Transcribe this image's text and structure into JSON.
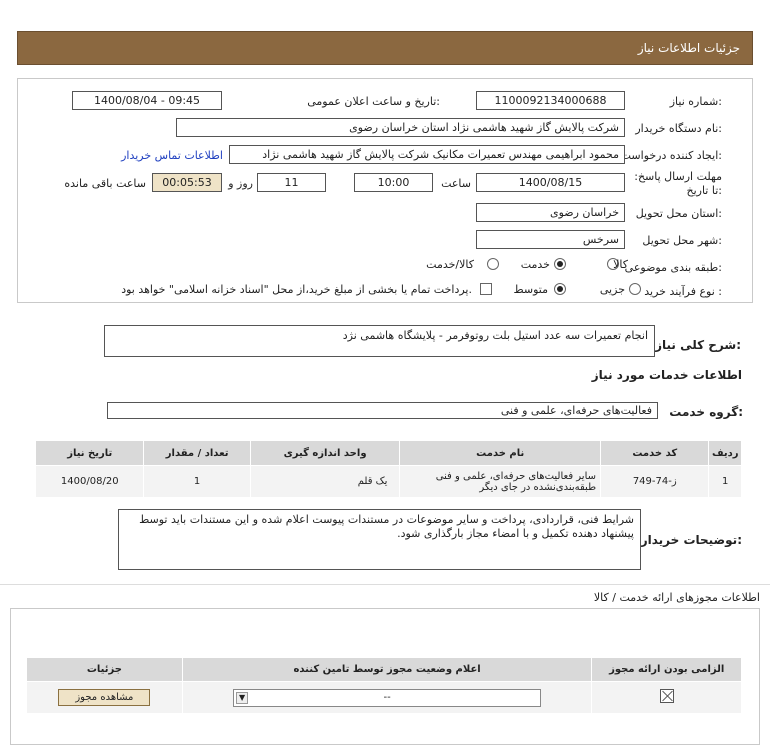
{
  "header": {
    "title": "جزئیات اطلاعات نیاز"
  },
  "fields": {
    "need_number_label": "شماره نیاز:",
    "need_number": "1100092134000688",
    "announce_label": "تاریخ و ساعت اعلان عمومی:",
    "announce_value": "1400/08/04 - 09:45",
    "buyer_org_label": "نام دستگاه خریدار:",
    "buyer_org": "شرکت پالایش گاز شهید هاشمی نژاد   استان خراسان رضوی",
    "creator_label": "ایجاد کننده درخواست:",
    "creator": "محمود ابراهیمی مهندس تعمیرات مکانیک شرکت پالایش گاز شهید هاشمی نژاد",
    "contact_link": "اطلاعات تماس خریدار",
    "deadline_label": "مهلت ارسال پاسخ: تا تاریخ:",
    "deadline_date": "1400/08/15",
    "time_label": "ساعت",
    "deadline_time": "10:00",
    "days_value": "11",
    "days_label": "روز و",
    "remaining_time": "00:05:53",
    "remaining_label": "ساعت باقی مانده",
    "province_label": "استان محل تحویل:",
    "province": "خراسان رضوی",
    "city_label": "شهر محل تحویل:",
    "city": "سرخس",
    "category_label": "طبقه بندی موضوعی:",
    "category_options": [
      "کالا",
      "خدمت",
      "کالا/خدمت"
    ],
    "category_selected": "خدمت",
    "process_label": "نوع فرآیند خرید :",
    "process_options": [
      "جزیی",
      "متوسط"
    ],
    "process_selected": "متوسط",
    "payment_note": "پرداخت تمام یا بخشی از مبلغ خرید،از محل \"اسناد خزانه اسلامی\" خواهد بود."
  },
  "summary": {
    "label": "شرح کلی نیاز:",
    "text": "انجام  تعمیرات سه عدد استیل بلت روتوفرمر - پلایشگاه هاشمی نژد"
  },
  "services": {
    "section_title": "اطلاعات خدمات مورد نیاز",
    "group_label": "گروه خدمت:",
    "group_value": "فعالیت‌های حرفه‌ای، علمی و فنی"
  },
  "items_table": {
    "headers": [
      "ردیف",
      "کد خدمت",
      "نام خدمت",
      "واحد اندازه گیری",
      "تعداد / مقدار",
      "تاریخ نیاز"
    ],
    "rows": [
      [
        "1",
        "ز-74-749",
        "سایر فعالیت‌های حرفه‌ای، علمی و فنی طبقه‌بندی‌نشده در جای دیگر",
        "یک قلم",
        "1",
        "1400/08/20"
      ]
    ]
  },
  "buyer_notes": {
    "label": "توضیحات خریدار:",
    "text": "شرایط فنی، قراردادی، پرداخت و سایر موضوعات در مستندات پیوست اعلام شده و این مستندات باید توسط پیشنهاد دهنده تکمیل و با امضاء مجاز بارگذاری شود."
  },
  "licenses": {
    "section_title": "اطلاعات مجوزهای ارائه خدمت / کالا",
    "headers": [
      "الزامی بودن ارائه مجوز",
      "اعلام وضعیت مجوز توسط تامین کننده",
      "جزئیات"
    ],
    "select_value": "--",
    "view_button": "مشاهده مجوز"
  }
}
